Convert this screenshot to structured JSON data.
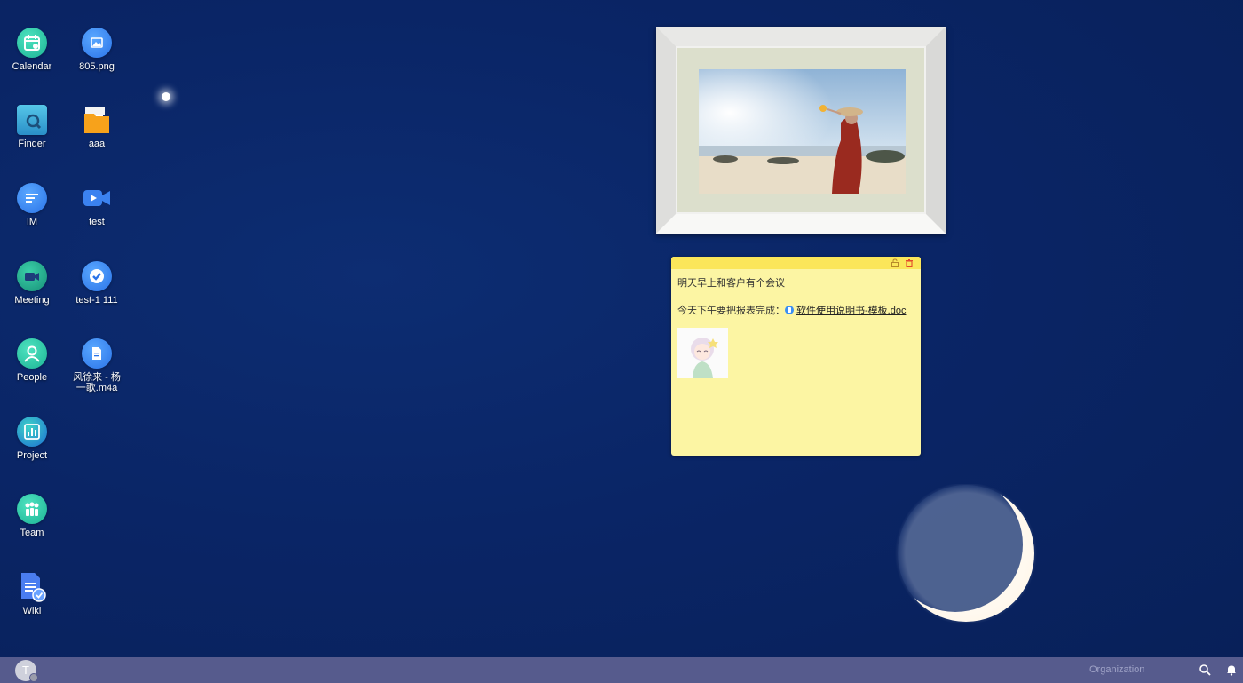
{
  "desktop": {
    "icons_col1": [
      {
        "label": "Calendar",
        "icon": "calendar-icon"
      },
      {
        "label": "Finder",
        "icon": "finder-icon"
      },
      {
        "label": "IM",
        "icon": "chat-icon"
      },
      {
        "label": "Meeting",
        "icon": "video-meeting-icon"
      },
      {
        "label": "People",
        "icon": "person-icon"
      },
      {
        "label": "Project",
        "icon": "project-chart-icon"
      },
      {
        "label": "Team",
        "icon": "team-icon"
      },
      {
        "label": "Wiki",
        "icon": "wiki-doc-icon"
      }
    ],
    "icons_col2": [
      {
        "label": "805.png",
        "icon": "image-file-icon"
      },
      {
        "label": "aaa",
        "icon": "folder-icon"
      },
      {
        "label": "test",
        "icon": "video-file-icon"
      },
      {
        "label": "test-1 111",
        "icon": "task-check-icon"
      },
      {
        "label": "风徐来 - 杨一歌.m4a",
        "icon": "audio-file-icon"
      }
    ]
  },
  "sticky_note": {
    "line1": "明天早上和客户有个会议",
    "line2_prefix": "今天下午要把报表完成：",
    "doc_link": "软件使用说明书-模板.doc"
  },
  "taskbar": {
    "avatar_initial": "T",
    "org_label": "Organization"
  },
  "colors": {
    "desktop_bg": "#0a2566",
    "taskbar_bg": "#565b8d",
    "note_bg": "#fcf5a3",
    "note_bar": "#fbe65a"
  }
}
